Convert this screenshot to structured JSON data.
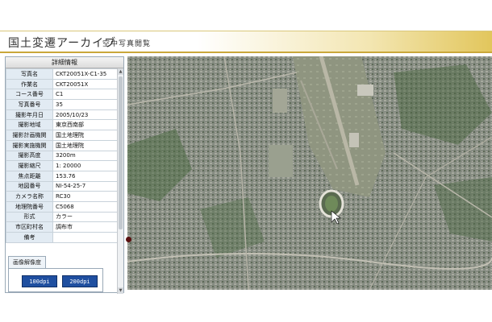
{
  "header": {
    "title": "国土変遷アーカイブ",
    "subtitle": "空中写真閲覧"
  },
  "panel": {
    "title": "詳細情報",
    "rows": [
      {
        "label": "写真名",
        "value": "CKT20051X-C1-35"
      },
      {
        "label": "作業名",
        "value": "CKT20051X"
      },
      {
        "label": "コース番号",
        "value": "C1"
      },
      {
        "label": "写真番号",
        "value": "35"
      },
      {
        "label": "撮影年月日",
        "value": "2005/10/23"
      },
      {
        "label": "撮影地域",
        "value": "東京西南部"
      },
      {
        "label": "撮影計画機関",
        "value": "国土地理院"
      },
      {
        "label": "撮影実施機関",
        "value": "国土地理院"
      },
      {
        "label": "撮影高度",
        "value": "3200m"
      },
      {
        "label": "撮影縮尺",
        "value": "1: 20000"
      },
      {
        "label": "焦点距離",
        "value": "153.76"
      },
      {
        "label": "地図番号",
        "value": "NI-54-25-7"
      },
      {
        "label": "カメラ名称",
        "value": "RC30"
      },
      {
        "label": "地理院番号",
        "value": "C5068"
      },
      {
        "label": "形式",
        "value": "カラー"
      },
      {
        "label": "市区町村名",
        "value": "調布市"
      },
      {
        "label": "備考",
        "value": ""
      }
    ]
  },
  "resolution": {
    "label": "画像解像度",
    "buttons": [
      "100dpi",
      "200dpi"
    ]
  },
  "colors": {
    "header_gold": "#e2c65c",
    "button_blue": "#1f4fa0",
    "label_bg": "#e2ebf3"
  }
}
